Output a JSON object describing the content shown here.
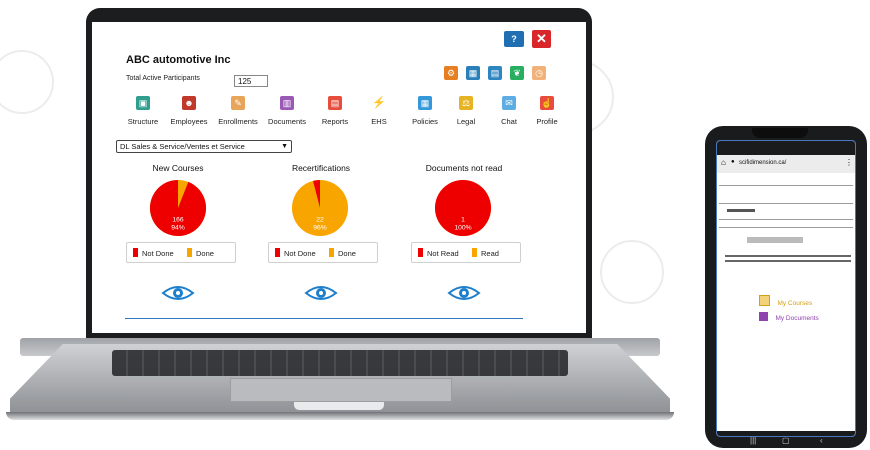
{
  "app": {
    "company_name": "ABC automotive Inc",
    "participants_label": "Total Active Participants",
    "participants_value": "125",
    "help_icon": "question-icon",
    "close_icon": "close-x-icon"
  },
  "toolbar_icons": [
    "settings-icon",
    "network-icon",
    "files-icon",
    "leaf-icon",
    "timer-icon"
  ],
  "nav": [
    {
      "label": "Structure",
      "icon": "structure-icon",
      "color": "#2f9e8f"
    },
    {
      "label": "Employees",
      "icon": "employees-icon",
      "color": "#c0392b"
    },
    {
      "label": "Enrollments",
      "icon": "enrollments-icon",
      "color": "#e8a55a"
    },
    {
      "label": "Documents",
      "icon": "documents-icon",
      "color": "#9b59b6"
    },
    {
      "label": "Reports",
      "icon": "reports-icon",
      "color": "#e74c3c"
    },
    {
      "label": "EHS",
      "icon": "ehs-icon",
      "color": "#d35400"
    },
    {
      "label": "Policies",
      "icon": "policies-icon",
      "color": "#3498db"
    },
    {
      "label": "Legal",
      "icon": "legal-icon",
      "color": "#e6b422"
    },
    {
      "label": "Chat",
      "icon": "chat-icon",
      "color": "#5dade2"
    },
    {
      "label": "Profile",
      "icon": "profile-icon",
      "color": "#e74c3c"
    }
  ],
  "department_select": {
    "value": "DL Sales & Service/Ventes et Service"
  },
  "panels": [
    {
      "title": "New Courses",
      "pie_count": "166",
      "pie_percent": "94%",
      "fraction_red": 0.94,
      "legend": [
        "Not Done",
        "Done"
      ]
    },
    {
      "title": "Recertifications",
      "pie_count": "22",
      "pie_percent": "96%",
      "fraction_red": 0.04,
      "legend": [
        "Not Done",
        "Done"
      ]
    },
    {
      "title": "Documents not read",
      "pie_count": "1",
      "pie_percent": "100%",
      "fraction_red": 1.0,
      "legend": [
        "Not Read",
        "Read"
      ]
    }
  ],
  "colors": {
    "red": "#ee0000",
    "orange": "#f9a500",
    "blue": "#1f6fb2",
    "eye": "#1d7fcc"
  },
  "phone": {
    "url": "scifidimension.ca/",
    "links": [
      {
        "label": "My Courses",
        "icon": "courses-icon",
        "color": "#d4a017"
      },
      {
        "label": "My Documents",
        "icon": "documents-icon",
        "color": "#8e44ad"
      }
    ]
  }
}
